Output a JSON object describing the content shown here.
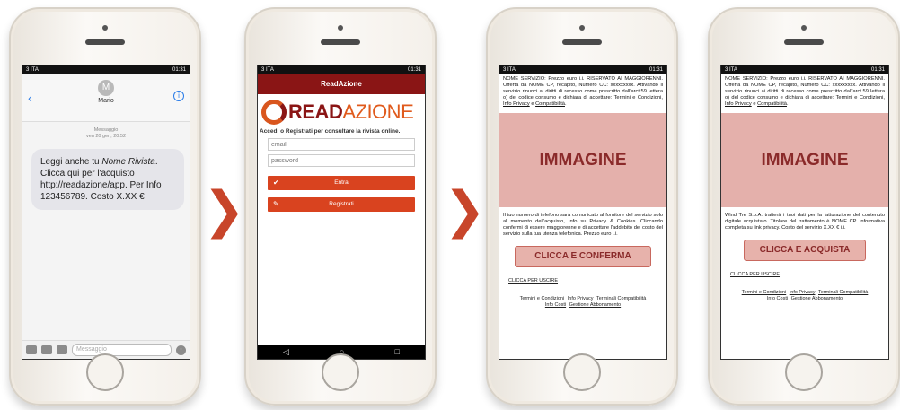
{
  "status": {
    "carrier": "3 ITA",
    "time": "01:31"
  },
  "sms": {
    "contact_initial": "M",
    "contact_name": "Mario",
    "meta_line1": "Messaggio",
    "meta_line2": "ven 20 gen, 20:52",
    "msg_part1": "Leggi anche tu ",
    "msg_italic": "Nome Rivista",
    "msg_part2": ". Clicca qui per l'acquisto http://readazione/app. Per Info 123456789. Costo X.XX €",
    "input_placeholder": "Messaggio"
  },
  "arrows": {
    "glyph": "❯"
  },
  "app": {
    "title": "ReadAzione",
    "logo_bold": "READ",
    "logo_rest": "AZIONE",
    "subtitle": "Accedi o Registrati per consultare la rivista online.",
    "email_placeholder": "email",
    "password_placeholder": "password",
    "enter_label": "Entra",
    "register_label": "Registrati"
  },
  "lp": {
    "legal_text": "NOME SERVIZIO: Prezzo euro i.i. RISERVATO AI MAGGIORENNI. Offerta da NOME CP, recapito, Numero CC: xxxxxxxxx. Attivando il servizio rinunci ai diritti di recesso come prescritto dall'arct.59 lettera o) del codice consumo e dichiara di accettare:",
    "link_terms": "Termini e Condizioni",
    "link_privacy": "Info Privacy",
    "and": "e",
    "link_compat": "Compatibilità",
    "image_label": "IMMAGINE",
    "exit_label": "CLICCA PER USCIRE",
    "footer_terms": "Termini e Condizioni",
    "footer_privacy": "Info Privacy",
    "footer_terminals": "Terminali Compatibilità",
    "footer_costs": "Info Costi",
    "footer_manage": "Gestione Abbonamento"
  },
  "lp3": {
    "info_text": "Il tuo numero di telefono sarà comunicato al fornitore del servizio solo al momento dell'acquisto, Info su Privacy & Cookies. Cliccando confermi di essere maggiorenne e di accettare l'addebito del costo del servizio sulla tua utenza telefonica. Prezzo euro i.i.",
    "cta": "CLICCA E CONFERMA"
  },
  "lp4": {
    "info_text": "Wind Tre S.p.A. tratterà i tuoi dati per la fatturazione del contenuto digitale acquistato. Titolare del trattamento è NOME CP. Informativa completa su link privacy. Costo del servizio X.XX € i.i.",
    "cta": "CLICCA E ACQUISTA"
  }
}
